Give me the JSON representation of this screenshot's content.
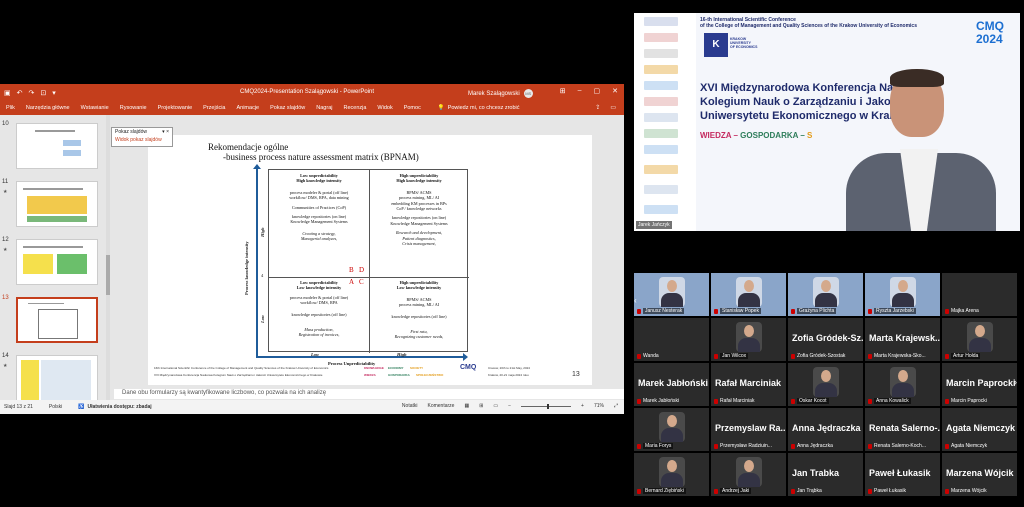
{
  "ppt": {
    "doc_title": "CMQ2024-Presentation Szalągowski  -  PowerPoint",
    "user_name": "Marek Szalągowski",
    "user_initials": "MS",
    "menu": [
      "Plik",
      "Narzędzia główne",
      "Wstawianie",
      "Rysowanie",
      "Projektowanie",
      "Przejścia",
      "Animacje",
      "Pokaz slajdów",
      "Nagraj",
      "Recenzja",
      "Widok",
      "Pomoc"
    ],
    "tell_me": "Powiedz mi, co chcesz zrobić",
    "thumbs": [
      {
        "num": "10",
        "star": "★"
      },
      {
        "num": "11",
        "star": "★"
      },
      {
        "num": "12",
        "star": "★"
      },
      {
        "num": "13",
        "star": ""
      },
      {
        "num": "14",
        "star": "★"
      }
    ],
    "dropdown": {
      "opt1": "Pokaz slajdów",
      "opt2": "Widok pokaz slajdów"
    },
    "notes": "Dane obu formularzy są kwantyfikowane liczbowo, co pozwala na ich analizę",
    "status": {
      "slide": "Slajd 13 z 21",
      "lang": "Polski",
      "access": "Ułatwienia dostępu: zbadaj",
      "notes_btn": "Notatki",
      "comments_btn": "Komentarze",
      "zoom": "71%"
    }
  },
  "slide": {
    "title1": "Rekomendacje ogólne",
    "title2": "-business process nature assessment matrix (BPNAM)",
    "cells": {
      "tl": {
        "h1": "Low unpredictability",
        "h2": "High knowledge intensity",
        "l1": "process modeler & portal (off line)",
        "l2": "workflow/ DMS, RPA, data mining",
        "l3": "Communities of Practices (CoP)",
        "l4": "knowledge repositories (on line)",
        "l5": "Knowledge Management Systems",
        "i1": "Creating a strategy,",
        "i2": "Managerial analyzes,"
      },
      "tr": {
        "h1": "High unpredictability",
        "h2": "High knowledge intensity",
        "l1": "BPMS/ ACMS",
        "l2": "process mining, ML/ AI",
        "l3": "embedding KM processes in BPs",
        "l4": "CoP / knowledge networks",
        "l5": "knowledge repositories (on line)",
        "l6": "Knowledge Management Systems",
        "i1": "Research and development,",
        "i2": "Patient diagnostics,",
        "i3": "Crisis management,"
      },
      "bl": {
        "h1": "Low unpredictability",
        "h2": "Low knowledge intensity",
        "l1": "process modeler & portal (off line)",
        "l2": "workflow/ DMS, RPA",
        "l3": "knowledge repositories (off line)",
        "i1": "Mass production,",
        "i2": "Registration of invoices,"
      },
      "br": {
        "h1": "High unpredictability",
        "h2": "Low knowledge intensity",
        "l1": "BPMS/ ACMS",
        "l2": "process mining, ML/ AI",
        "l3": "knowledge repositories (off line)",
        "i1": "First ratu,",
        "i2": "Recognizing customer needs,"
      }
    },
    "letters": {
      "a": "A",
      "b": "B",
      "c": "C",
      "d": "D"
    },
    "axis_x": "Process Unpredictability",
    "axis_y": "Process knowledge intensity",
    "x_low": "Low",
    "x_high": "High",
    "y_low": "Low",
    "y_high": "High",
    "y_mid": "4",
    "footer1": "16th International Scientific Conference of the College of Management and Quality Sciences of the Krakow University of Economics",
    "footer2": "XVI Międzynarodowa Konferencja Naukowa Kolegium Nauk o Zarządzaniu i Jakości Uniwersytetu Ekonomicznego w Krakowie",
    "kw1": "WIEDZA",
    "kw2": "GOSPODARKA",
    "kw3": "SPOŁECZEŃSTWO",
    "kw4": "KNOWLEDGE",
    "kw5": "ECONOMY",
    "kw6": "SOCIETY",
    "cmq": "CMQ",
    "date1": "Cracow, 20th to 21st May, 2024",
    "date2": "Kraków, 20-21 maja 2024 roku",
    "num": "13"
  },
  "conference": {
    "top1": "16-th International Scientific Conference",
    "top2": "of the College of Management and Quality Sciences of the Krakow University of Economics",
    "kr_letter": "K",
    "kr1": "KRAKOW",
    "kr2": "UNIVERSITY",
    "kr3": "OF ECONOMICS",
    "cmq1": "CMQ",
    "cmq2": "2024",
    "main1": "XVI Międzynarodowa Konferencja Naukowa",
    "main2": "Kolegium Nauk o Zarządzaniu i Jakości",
    "main3": "Uniwersytetu Ekonomicznego w Krakowie",
    "sub1": "WIEDZA",
    "sub_sep": " – ",
    "sub2": "GOSPODARKA",
    "sub3": "S",
    "speaker_name": "Jarek Jańczyk"
  },
  "gallery": [
    {
      "name": "Janusz Nesterak",
      "type": "img"
    },
    {
      "name": "Stanisław Popek",
      "type": "img"
    },
    {
      "name": "Grażyna Plichta",
      "type": "img"
    },
    {
      "name": "Ryszta Jarzebski",
      "type": "img"
    },
    {
      "name": "Majka Arena",
      "type": "dark"
    },
    {
      "name": "Wanda",
      "type": "dark"
    },
    {
      "name": "Jan Wilcox",
      "type": "face"
    },
    {
      "big": "Zofia Gródek-Sz...",
      "name": "Zofia Gródek-Szostak",
      "type": "text"
    },
    {
      "big": "Marta Krajewsk...",
      "name": "Marta Krajewska-Sko...",
      "type": "text"
    },
    {
      "name": "Artur Hołda",
      "type": "face"
    },
    {
      "big": "Marek Jabłoński",
      "name": "Marek Jabłoński",
      "type": "text"
    },
    {
      "big": "Rafał Marciniak",
      "name": "Rafał Marciniak",
      "type": "text"
    },
    {
      "name": "Oskar Kocot",
      "type": "face"
    },
    {
      "name": "Anna Kowalick",
      "type": "face"
    },
    {
      "big": "Marcin Paprocki",
      "name": "Marcin Paprocki",
      "type": "text"
    },
    {
      "name": "Maria Forys",
      "type": "face"
    },
    {
      "big": "Przemyslaw Ra...",
      "name": "Przemysław Radziuin...",
      "type": "text"
    },
    {
      "big": "Anna Jędraczka",
      "name": "Anna Jędraczka",
      "type": "text"
    },
    {
      "big": "Renata Salerno-...",
      "name": "Renata Salerno-Koch...",
      "type": "text"
    },
    {
      "big": "Agata Niemczyk",
      "name": "Agata Niemczyk",
      "type": "text"
    },
    {
      "name": "Bernard Ziębiński",
      "type": "face"
    },
    {
      "name": "Andrzej Jaki",
      "type": "face"
    },
    {
      "big": "Jan Trabka",
      "name": "Jan Trąbka",
      "type": "text"
    },
    {
      "big": "Paweł Łukasik",
      "name": "Paweł Łukasik",
      "type": "text"
    },
    {
      "big": "Marzena Wójcik",
      "name": "Marzena Wójcik",
      "type": "text"
    }
  ],
  "colors": {
    "ppt_accent": "#c43e1c",
    "axis": "#1f5c9a",
    "cmq_blue": "#1c6fd1",
    "navy": "#1f2b6b",
    "wiedza": "#c42a5f",
    "gospodarka": "#2d7d5a",
    "spoleczenstwo": "#e39b17"
  }
}
